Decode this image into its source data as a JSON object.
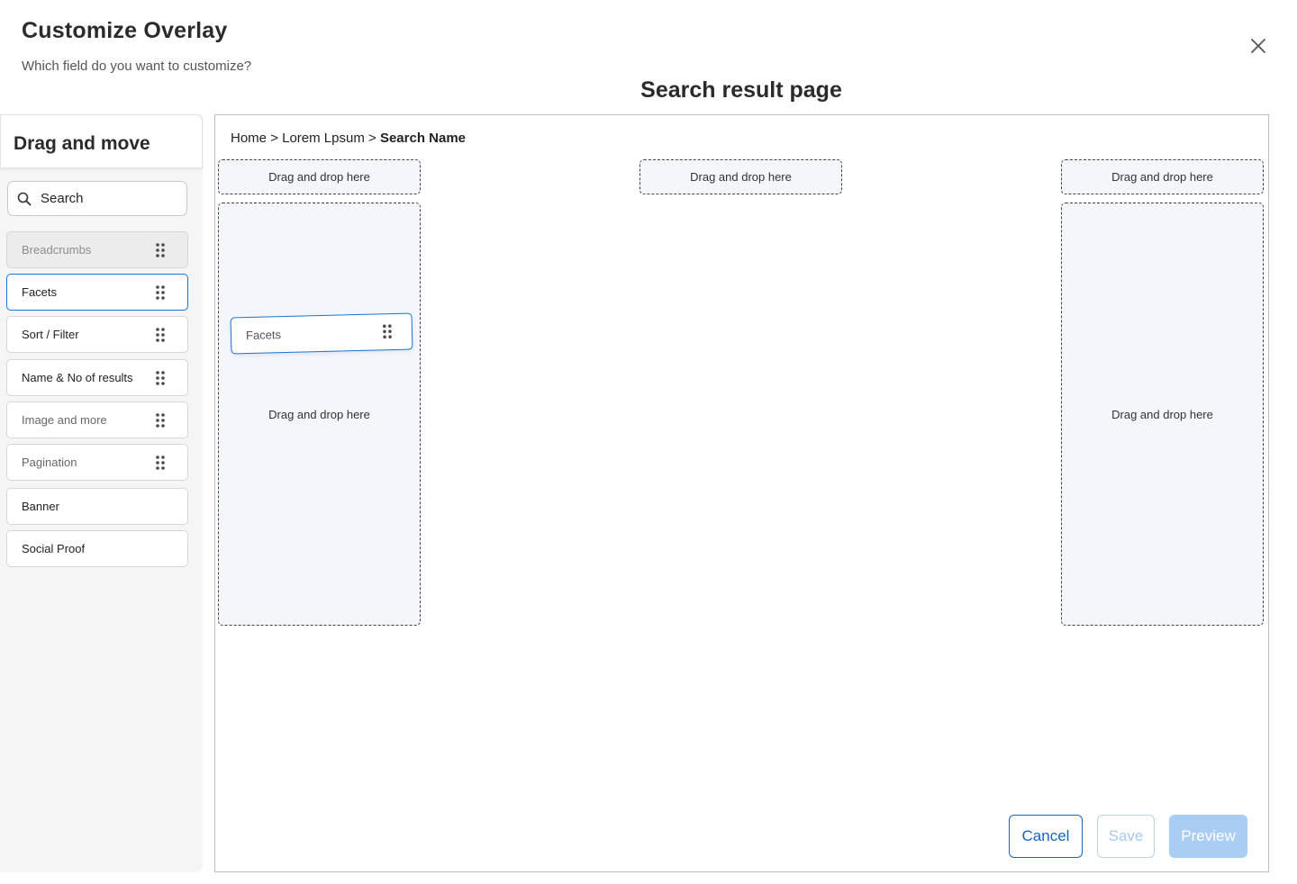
{
  "header": {
    "title": "Customize Overlay",
    "subtitle": "Which field do you want to customize?",
    "page_heading": "Search result page"
  },
  "sidebar": {
    "title": "Drag and move",
    "search_placeholder": "Search",
    "items": [
      {
        "label": "Breadcrumbs",
        "state": "disabled"
      },
      {
        "label": "Facets",
        "state": "selected"
      },
      {
        "label": "Sort / Filter",
        "state": "normal"
      },
      {
        "label": "Name & No of results",
        "state": "normal"
      },
      {
        "label": "Image and more",
        "state": "muted"
      },
      {
        "label": "Pagination",
        "state": "muted"
      },
      {
        "label": "Banner",
        "state": "normal"
      },
      {
        "label": "Social Proof",
        "state": "normal"
      }
    ]
  },
  "canvas": {
    "breadcrumb": {
      "part1": "Home",
      "sep": ">",
      "part2": "Lorem Lpsum",
      "current": "Search Name"
    },
    "drop_label": "Drag and drop here",
    "dragging_label": "Facets"
  },
  "actions": {
    "cancel": "Cancel",
    "save": "Save",
    "preview": "Preview"
  },
  "colors": {
    "accent": "#1a73d9",
    "drop_bg": "#f3f7fc",
    "preview_bg": "#a9cdf3"
  }
}
